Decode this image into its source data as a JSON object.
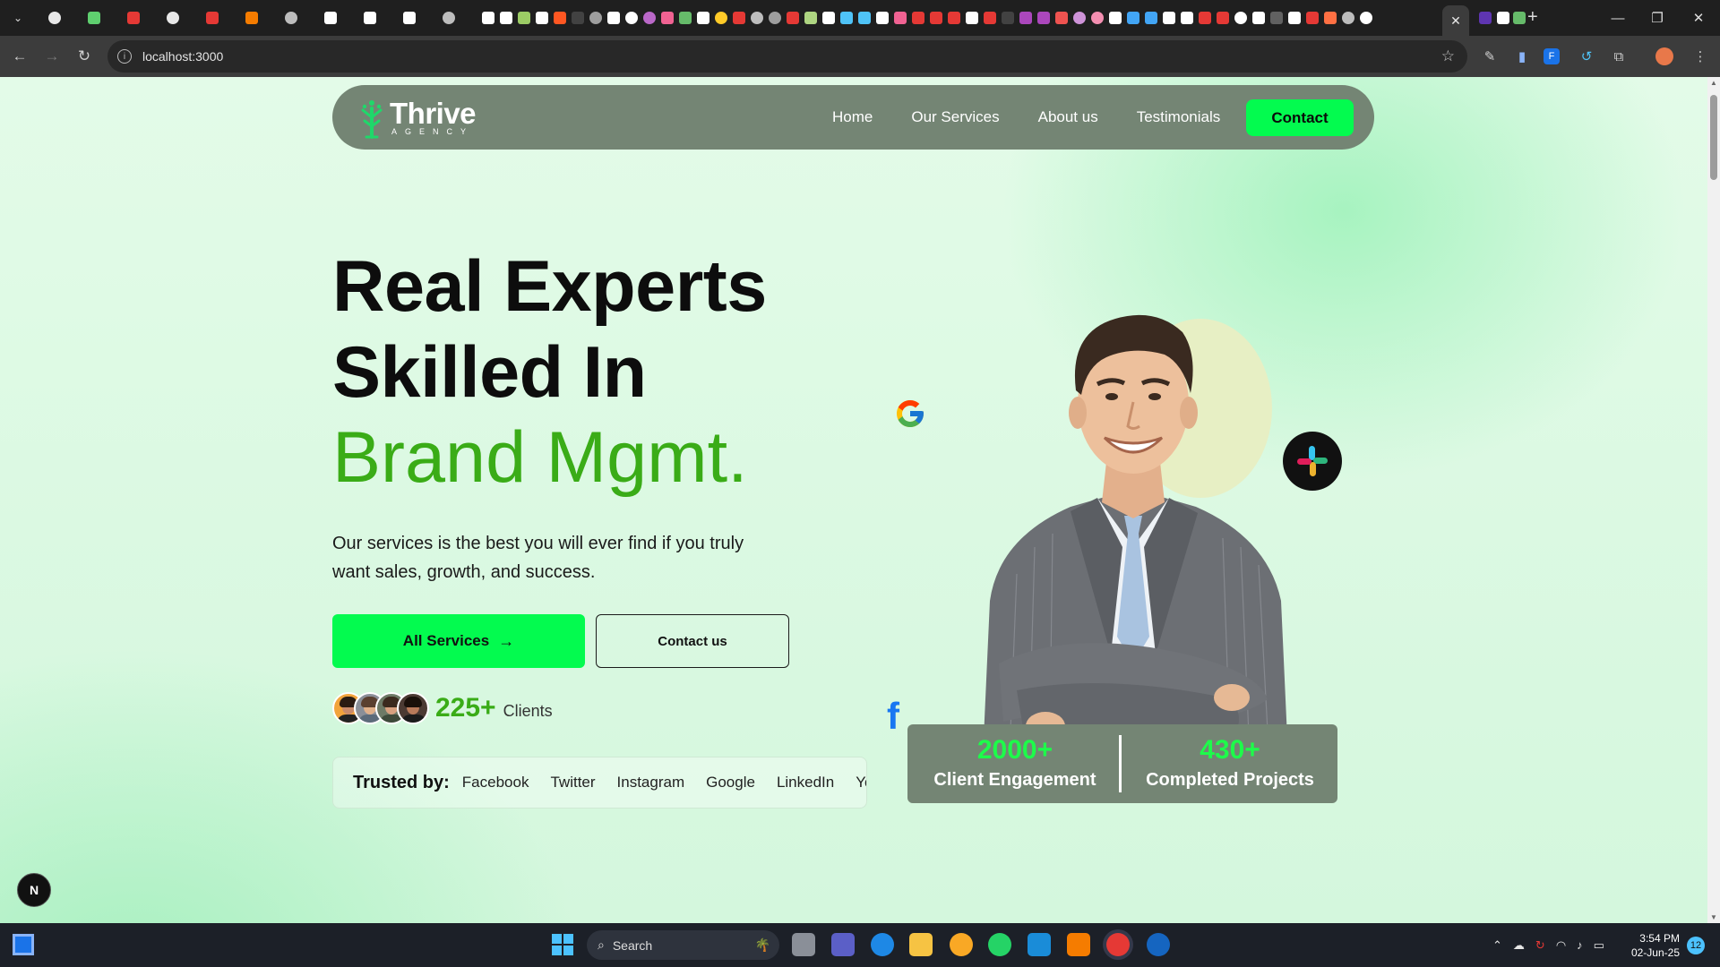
{
  "browser": {
    "address": "localhost:3000",
    "active_tab_close": "✕",
    "new_tab": "+",
    "window_controls": {
      "minimize": "—",
      "restore": "❐",
      "close": "✕"
    }
  },
  "navbar": {
    "logo_name": "Thrive",
    "logo_sub": "AGENCY",
    "links": [
      "Home",
      "Our Services",
      "About us",
      "Testimonials"
    ],
    "contact_label": "Contact"
  },
  "hero": {
    "title_line1": "Real Experts",
    "title_line2": "Skilled In",
    "title_accent": "Brand Mgmt.",
    "description": "Our services is the best you will ever find if you truly want sales, growth, and success.",
    "primary_cta": "All Services",
    "primary_cta_icon": "arrow-right-icon",
    "secondary_cta": "Contact us",
    "clients_count": "225+",
    "clients_label": "Clients"
  },
  "trusted": {
    "label": "Trusted by:",
    "brands": [
      "Facebook",
      "Twitter",
      "Instagram",
      "Google",
      "LinkedIn",
      "You"
    ]
  },
  "stats": [
    {
      "value": "2000+",
      "label": "Client Engagement"
    },
    {
      "value": "430+",
      "label": "Completed Projects"
    }
  ],
  "floating_icons": [
    "google-icon",
    "facebook-icon",
    "slack-icon"
  ],
  "dev_badge": "N",
  "taskbar": {
    "search_label": "Search",
    "time": "3:54 PM",
    "date": "02-Jun-25",
    "notifications": "12"
  },
  "colors": {
    "accent_green": "#03fb4f",
    "text_green": "#3aac17",
    "nav_bg": "#748574",
    "page_bg": "#d9f9e1"
  }
}
